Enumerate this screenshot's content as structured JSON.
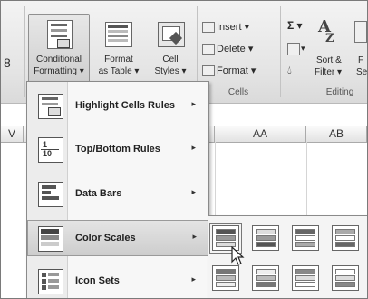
{
  "ribbon": {
    "left_cut_label": "8",
    "conditional_formatting": {
      "line1": "Conditional",
      "line2": "Formatting ▾"
    },
    "format_as_table": {
      "line1": "Format",
      "line2": "as Table ▾"
    },
    "cell_styles": {
      "line1": "Cell",
      "line2": "Styles ▾"
    },
    "insert": "Insert ▾",
    "delete": "Delete ▾",
    "format": "Format ▾",
    "cells_group": "Cells",
    "autosum_arrow": "Σ ▾",
    "sort_filter": {
      "line1": "Sort &",
      "line2": "Filter ▾"
    },
    "find_cut": {
      "line1": "F",
      "line2": "Se"
    },
    "editing_group": "Editing"
  },
  "sheet": {
    "col_left": "V",
    "col_aa": "AA",
    "col_ab": "AB"
  },
  "menu": {
    "items": [
      {
        "label": "Highlight Cells Rules",
        "icon": "highlight-cells-icon"
      },
      {
        "label": "Top/Bottom Rules",
        "icon": "top-bottom-icon"
      },
      {
        "label": "Data Bars",
        "icon": "data-bars-icon"
      },
      {
        "label": "Color Scales",
        "icon": "color-scales-icon"
      },
      {
        "label": "Icon Sets",
        "icon": "icon-sets-icon"
      }
    ],
    "arrow": "▸"
  }
}
